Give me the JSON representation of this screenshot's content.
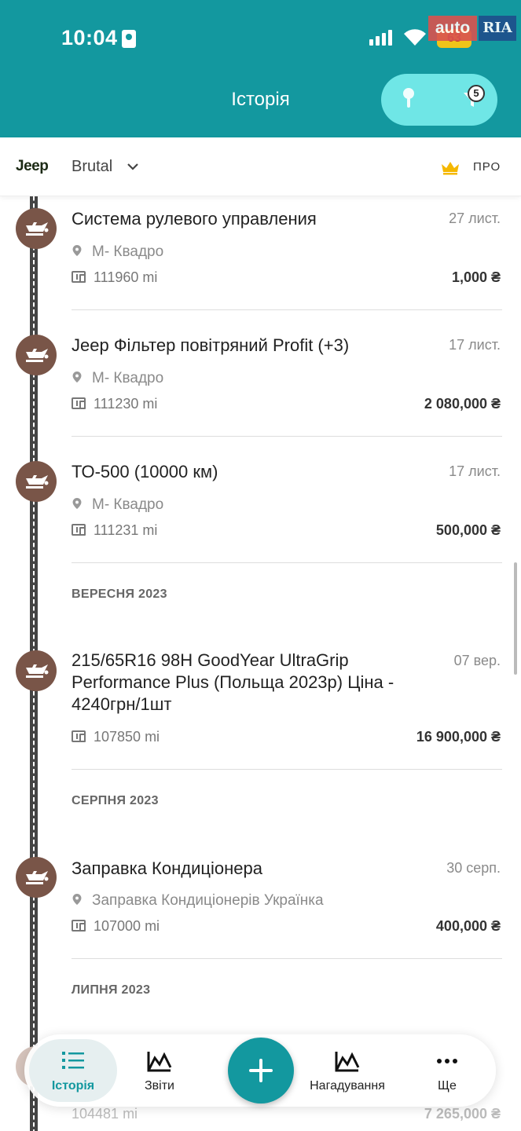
{
  "status_bar": {
    "time": "10:04",
    "battery": "63",
    "watermark_left": "auto",
    "watermark_right": "RIA"
  },
  "header": {
    "title": "Історія",
    "filter_badge": "5"
  },
  "vehicle_bar": {
    "brand": "Jeep",
    "vehicle_name": "Brutal",
    "pro_label": "ПРО"
  },
  "entries_top": [
    {
      "title": "Система рулевого управления",
      "date": "27 лист.",
      "location": "М- Квадро",
      "odometer": "111960 mi",
      "cost": "1,000 ₴"
    },
    {
      "title": "Jeep Фільтер  повітряний Profit (+3)",
      "date": "17 лист.",
      "location": "М- Квадро",
      "odometer": "111230 mi",
      "cost": "2 080,000 ₴"
    },
    {
      "title": "ТО-500 (10000 км)",
      "date": "17 лист.",
      "location": "М- Квадро",
      "odometer": "111231 mi",
      "cost": "500,000 ₴"
    }
  ],
  "section_september": "ВЕРЕСНЯ 2023",
  "entry_september": {
    "title": "215/65R16 98H GoodYear UltraGrip Performance Plus (Польща 2023р) Ціна - 4240грн/1шт",
    "date": "07 вер.",
    "odometer": "107850 mi",
    "cost": "16 900,000 ₴"
  },
  "section_august": "СЕРПНЯ 2023",
  "entry_august": {
    "title": "Заправка Кондиціонера",
    "date": "30 серп.",
    "location": "Заправка Кондиціонерів Українка",
    "odometer": "107000 mi",
    "cost": "400,000 ₴"
  },
  "section_july": "ЛИПНЯ 2023",
  "entry_peek": {
    "odometer": "104481 mi",
    "cost": "7 265,000 ₴"
  },
  "bottom_nav": {
    "history": "Історія",
    "reports": "Звіти",
    "reminders": "Нагадування",
    "more": "Ще"
  }
}
